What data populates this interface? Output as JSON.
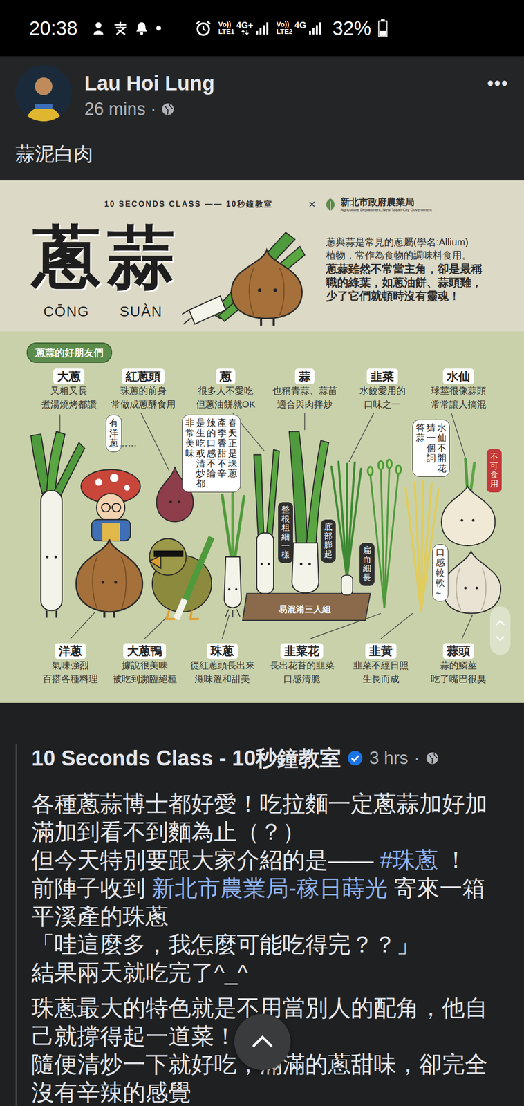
{
  "status_bar": {
    "time": "20:38",
    "sims": [
      {
        "voice": "Vo))",
        "band": "LTE1",
        "network": "4G+",
        "data_active": true
      },
      {
        "voice": "Vo))",
        "band": "LTE2",
        "network": "4G",
        "data_active": false
      }
    ],
    "battery": "32%",
    "battery_level": 0.32
  },
  "post": {
    "author": "Lau Hoi Lung",
    "time": "26 mins",
    "separator": "·",
    "more": "•••",
    "text": "蒜泥白肉"
  },
  "infographic": {
    "brand": "10 SECONDS CLASS —— 10秒鐘教室",
    "cross": "×",
    "partner": "新北市政府農業局",
    "partner_en": "Agriculture Department, New Taipei City Government",
    "title": "蔥蒜",
    "pinyin": [
      "CŌNG",
      "SUÀN"
    ],
    "intro": [
      "蔥與蒜是常見的蔥屬(學名:Allium)",
      "植物，常作為食物的調味料食用。"
    ],
    "highlight": [
      "蔥蒜雖然不常當主角，卻是最稱",
      "職的綠葉，如蔥油餅、蒜頭雞，",
      "少了它們就頓時沒有靈魂！"
    ],
    "friends_tag": "蔥蒜的好朋友們",
    "top_labels": [
      {
        "name": "大蔥",
        "desc": [
          "又粗又長",
          "煮湯燒烤都讚"
        ]
      },
      {
        "name": "紅蔥頭",
        "desc": [
          "珠蔥的前身",
          "常做成蔥酥食用"
        ]
      },
      {
        "name": "蔥",
        "desc": [
          "很多人不愛吃",
          "但蔥油餅就OK"
        ]
      },
      {
        "name": "蒜",
        "desc": [
          "也稱青蒜、蒜苗",
          "適合與肉拌炒"
        ]
      },
      {
        "name": "韭菜",
        "desc": [
          "水餃愛用的",
          "口味之一"
        ]
      },
      {
        "name": "水仙",
        "desc": [
          "球莖很像蒜頭",
          "常常讓人搞混"
        ]
      }
    ],
    "bottom_labels": [
      {
        "name": "洋蔥",
        "desc": [
          "氣味強烈",
          "百搭各種料理"
        ]
      },
      {
        "name": "大蔥鴨",
        "desc": [
          "據說很美味",
          "被吃到瀕臨絕種"
        ]
      },
      {
        "name": "珠蔥",
        "desc": [
          "從紅蔥頭長出來",
          "滋味溫和甜美"
        ]
      },
      {
        "name": "韭菜花",
        "desc": [
          "長出花苔的韭菜",
          "口感清脆"
        ]
      },
      {
        "name": "韭黃",
        "desc": [
          "韭菜不經日照",
          "生長而成"
        ]
      },
      {
        "name": "蒜頭",
        "desc": [
          "蒜的鱗莖",
          "吃了嘴巴很臭"
        ]
      }
    ],
    "bubbles": [
      {
        "kind": "light",
        "columns": [
          "有洋蔥……"
        ]
      },
      {
        "kind": "light",
        "columns": [
          "春天正是珠蔥",
          "產季！香甜不辛",
          "辣的口感不論",
          "是生吃或清炒都",
          "非常美味！"
        ]
      },
      {
        "kind": "dark",
        "columns": [
          "整根粗細一樣"
        ]
      },
      {
        "kind": "dark",
        "columns": [
          "底部膨起"
        ]
      },
      {
        "kind": "dark",
        "columns": [
          "扁而細長"
        ]
      },
      {
        "kind": "light",
        "columns": [
          "水仙不開花",
          "猜一個詞？",
          "答：蒜"
        ]
      },
      {
        "kind": "light",
        "columns": [
          "口感較軟~"
        ]
      },
      {
        "kind": "warning",
        "columns": [
          "不可食用"
        ]
      }
    ],
    "group_label": "易混淆三人組"
  },
  "shared_post": {
    "author": "10 Seconds Class - 10秒鐘教室",
    "verified": true,
    "time": "3 hrs",
    "separator": "·",
    "paragraphs": [
      {
        "lines": [
          [
            {
              "kind": "text",
              "text": "各種蔥蒜博士都好愛！吃拉麵一定蔥蒜加好加滿加到看不到麵為止（？）"
            }
          ],
          [
            {
              "kind": "text",
              "text": "但今天特別要跟大家介紹的是—— "
            },
            {
              "kind": "link",
              "text": "#珠蔥"
            },
            {
              "kind": "text",
              "text": " ！"
            }
          ],
          [
            {
              "kind": "text",
              "text": "前陣子收到 "
            },
            {
              "kind": "link",
              "text": "新北市農業局-稼日蒔光"
            },
            {
              "kind": "text",
              "text": " 寄來一箱平溪產的珠蔥"
            }
          ],
          [
            {
              "kind": "text",
              "text": "「哇這麼多，我怎麼可能吃得完？？」"
            }
          ],
          [
            {
              "kind": "text",
              "text": "結果兩天就吃完了^_^"
            }
          ]
        ]
      },
      {
        "lines": [
          [
            {
              "kind": "text",
              "text": "珠蔥最大的特色就是不用當別人的配角，他自己就撐得起一道菜！"
            }
          ],
          [
            {
              "kind": "text",
              "text": "隨便清炒一下就好吃，滿滿的蔥甜味，卻完全沒有辛辣的感覺"
            }
          ]
        ]
      }
    ]
  }
}
